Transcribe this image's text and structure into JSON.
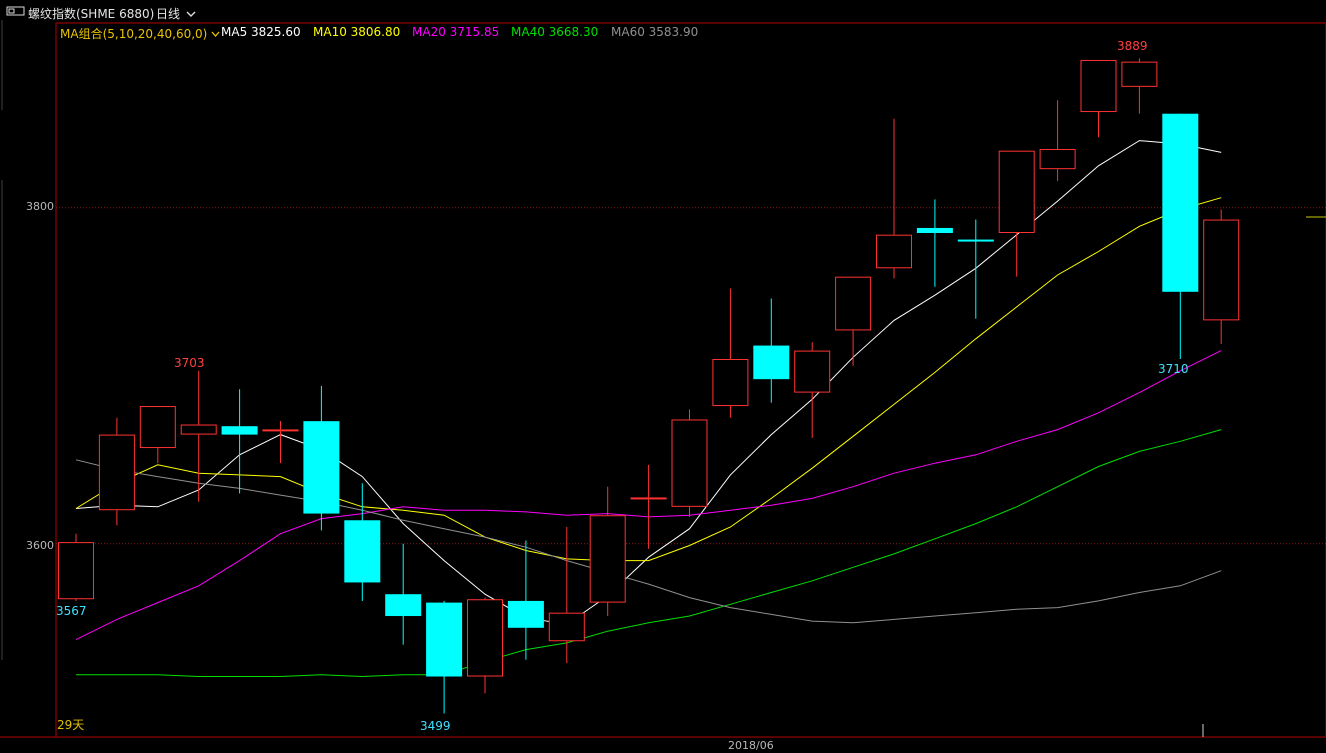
{
  "header": {
    "symbol": "螺纹指数(SHME 6880)",
    "period": "日线",
    "period_chevron": "chevron-down-icon",
    "window_icon": "window-icon"
  },
  "ma_bar": {
    "combo_label": "MA组合(5,10,20,40,60,0)",
    "items": [
      {
        "label": "MA5 3825.60",
        "color": "#ffffff"
      },
      {
        "label": "MA10 3806.80",
        "color": "#ffff00"
      },
      {
        "label": "MA20 3715.85",
        "color": "#ff00ff"
      },
      {
        "label": "MA40 3668.30",
        "color": "#00e000"
      },
      {
        "label": "MA60 3583.90",
        "color": "#909090"
      }
    ]
  },
  "colors": {
    "up": "#ff3232",
    "down": "#00ffff",
    "background": "#000000",
    "frame": "#b40000"
  },
  "chart_data": {
    "type": "candlestick",
    "y_ticks": [
      "3800",
      "3600"
    ],
    "x_label": "2018/06",
    "bars_label": "29天",
    "annotations": {
      "high": "3889",
      "high_left": "3703",
      "low": "3499",
      "low_right": "3710",
      "left_edge": "3567"
    },
    "ylim": [
      3485,
      3910
    ],
    "candles": [
      {
        "o": 3567,
        "h": 3606,
        "l": 3566,
        "c": 3601
      },
      {
        "o": 3620,
        "h": 3675,
        "l": 3611,
        "c": 3665
      },
      {
        "o": 3657,
        "h": 3675,
        "l": 3648,
        "c": 3682
      },
      {
        "o": 3665,
        "h": 3703,
        "l": 3625,
        "c": 3671
      },
      {
        "o": 3670,
        "h": 3692,
        "l": 3630,
        "c": 3665
      },
      {
        "o": 3667,
        "h": 3673,
        "l": 3648,
        "c": 3668
      },
      {
        "o": 3673,
        "h": 3694,
        "l": 3608,
        "c": 3618
      },
      {
        "o": 3614,
        "h": 3636,
        "l": 3566,
        "c": 3577
      },
      {
        "o": 3570,
        "h": 3600,
        "l": 3540,
        "c": 3557
      },
      {
        "o": 3565,
        "h": 3566,
        "l": 3499,
        "c": 3521
      },
      {
        "o": 3521,
        "h": 3568,
        "l": 3511,
        "c": 3567
      },
      {
        "o": 3566,
        "h": 3602,
        "l": 3531,
        "c": 3550
      },
      {
        "o": 3542,
        "h": 3610,
        "l": 3529,
        "c": 3559
      },
      {
        "o": 3565,
        "h": 3634,
        "l": 3557,
        "c": 3617
      },
      {
        "o": 3627,
        "h": 3647,
        "l": 3597,
        "c": 3627
      },
      {
        "o": 3622,
        "h": 3680,
        "l": 3616,
        "c": 3674
      },
      {
        "o": 3682,
        "h": 3752,
        "l": 3675,
        "c": 3710
      },
      {
        "o": 3718,
        "h": 3746,
        "l": 3684,
        "c": 3698
      },
      {
        "o": 3690,
        "h": 3720,
        "l": 3663,
        "c": 3715
      },
      {
        "o": 3727,
        "h": 3759,
        "l": 3706,
        "c": 3759
      },
      {
        "o": 3764,
        "h": 3853,
        "l": 3758,
        "c": 3784
      },
      {
        "o": 3788,
        "h": 3805,
        "l": 3753,
        "c": 3785
      },
      {
        "o": 3781,
        "h": 3793,
        "l": 3734,
        "c": 3780
      },
      {
        "o": 3785,
        "h": 3833,
        "l": 3759,
        "c": 3834
      },
      {
        "o": 3823,
        "h": 3864,
        "l": 3816,
        "c": 3835
      },
      {
        "o": 3857,
        "h": 3878,
        "l": 3842,
        "c": 3888
      },
      {
        "o": 3872,
        "h": 3889,
        "l": 3856,
        "c": 3887
      },
      {
        "o": 3856,
        "h": 3856,
        "l": 3710,
        "c": 3750
      },
      {
        "o": 3733,
        "h": 3799,
        "l": 3719,
        "c": 3793
      }
    ],
    "series": [
      {
        "name": "MA5",
        "color": "#ffffff",
        "values": [
          3621,
          3623,
          3622,
          3632,
          3653,
          3665,
          3656,
          3640,
          3612,
          3590,
          3570,
          3556,
          3552,
          3569,
          3592,
          3609,
          3641,
          3665,
          3686,
          3711,
          3733,
          3748,
          3764,
          3784,
          3804,
          3825,
          3840,
          3838,
          3833
        ]
      },
      {
        "name": "MA10",
        "color": "#ffff00",
        "values": [
          3621,
          3636,
          3647,
          3642,
          3641,
          3640,
          3630,
          3622,
          3620,
          3617,
          3604,
          3596,
          3591,
          3590,
          3590,
          3599,
          3610,
          3627,
          3645,
          3664,
          3683,
          3702,
          3722,
          3741,
          3760,
          3774,
          3789,
          3799,
          3806
        ]
      },
      {
        "name": "MA20",
        "color": "#ff00ff",
        "values": [
          3543,
          3555,
          3565,
          3575,
          3590,
          3606,
          3615,
          3618,
          3622,
          3620,
          3620,
          3619,
          3617,
          3618,
          3616,
          3617,
          3620,
          3623,
          3627,
          3634,
          3642,
          3648,
          3653,
          3661,
          3668,
          3678,
          3690,
          3703,
          3715
        ]
      },
      {
        "name": "MA40",
        "color": "#00e000",
        "values": [
          3522,
          3522,
          3522,
          3521,
          3521,
          3521,
          3522,
          3521,
          3522,
          3522,
          3530,
          3537,
          3541,
          3548,
          3553,
          3557,
          3564,
          3571,
          3578,
          3586,
          3594,
          3603,
          3612,
          3622,
          3634,
          3646,
          3655,
          3661,
          3668
        ]
      },
      {
        "name": "MA60",
        "color": "#909090",
        "values": [
          3650,
          3644,
          3640,
          3636,
          3633,
          3629,
          3625,
          3620,
          3614,
          3609,
          3604,
          3598,
          3590,
          3583,
          3576,
          3568,
          3562,
          3558,
          3554,
          3553,
          3555,
          3557,
          3559,
          3561,
          3562,
          3566,
          3571,
          3575,
          3584
        ]
      }
    ]
  }
}
